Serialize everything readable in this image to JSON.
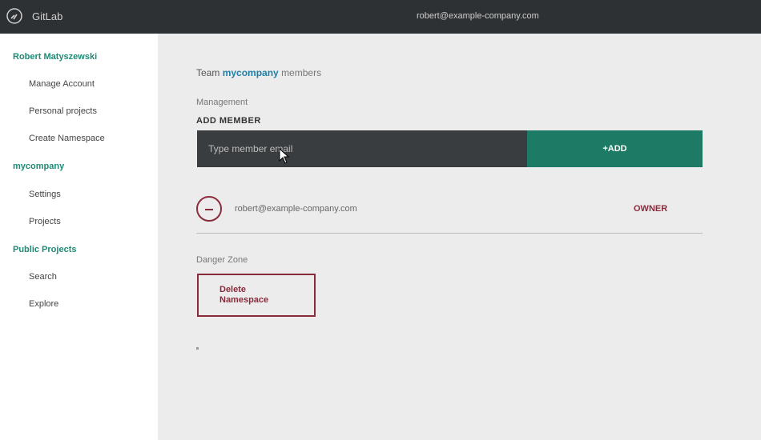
{
  "topbar": {
    "brand": "GitLab",
    "user_email": "robert@example-company.com"
  },
  "sidebar": {
    "user_name": "Robert Matyszewski",
    "user_items": [
      {
        "label": "Manage Account"
      },
      {
        "label": "Personal projects"
      },
      {
        "label": "Create Namespace"
      }
    ],
    "namespace_name": "mycompany",
    "namespace_items": [
      {
        "label": "Settings"
      },
      {
        "label": "Projects"
      }
    ],
    "public_header": "Public Projects",
    "public_items": [
      {
        "label": "Search"
      },
      {
        "label": "Explore"
      }
    ]
  },
  "main": {
    "title_prefix": "Team",
    "namespace": "mycompany",
    "title_suffix": "members",
    "members_label": "Management",
    "members_sub": "ADD MEMBER",
    "member_input_placeholder": "Type member email",
    "add_button": "+ADD",
    "members": [
      {
        "email": "robert@example-company.com",
        "role": "OWNER"
      }
    ],
    "danger_label": "Danger Zone",
    "delete_button_line1": "Delete",
    "delete_button_line2": "Namespace"
  },
  "colors": {
    "accent_green": "#1d7a64",
    "danger_red": "#8a2b3c",
    "link_blue": "#1f7fa8",
    "dark_bg": "#2e3133"
  }
}
